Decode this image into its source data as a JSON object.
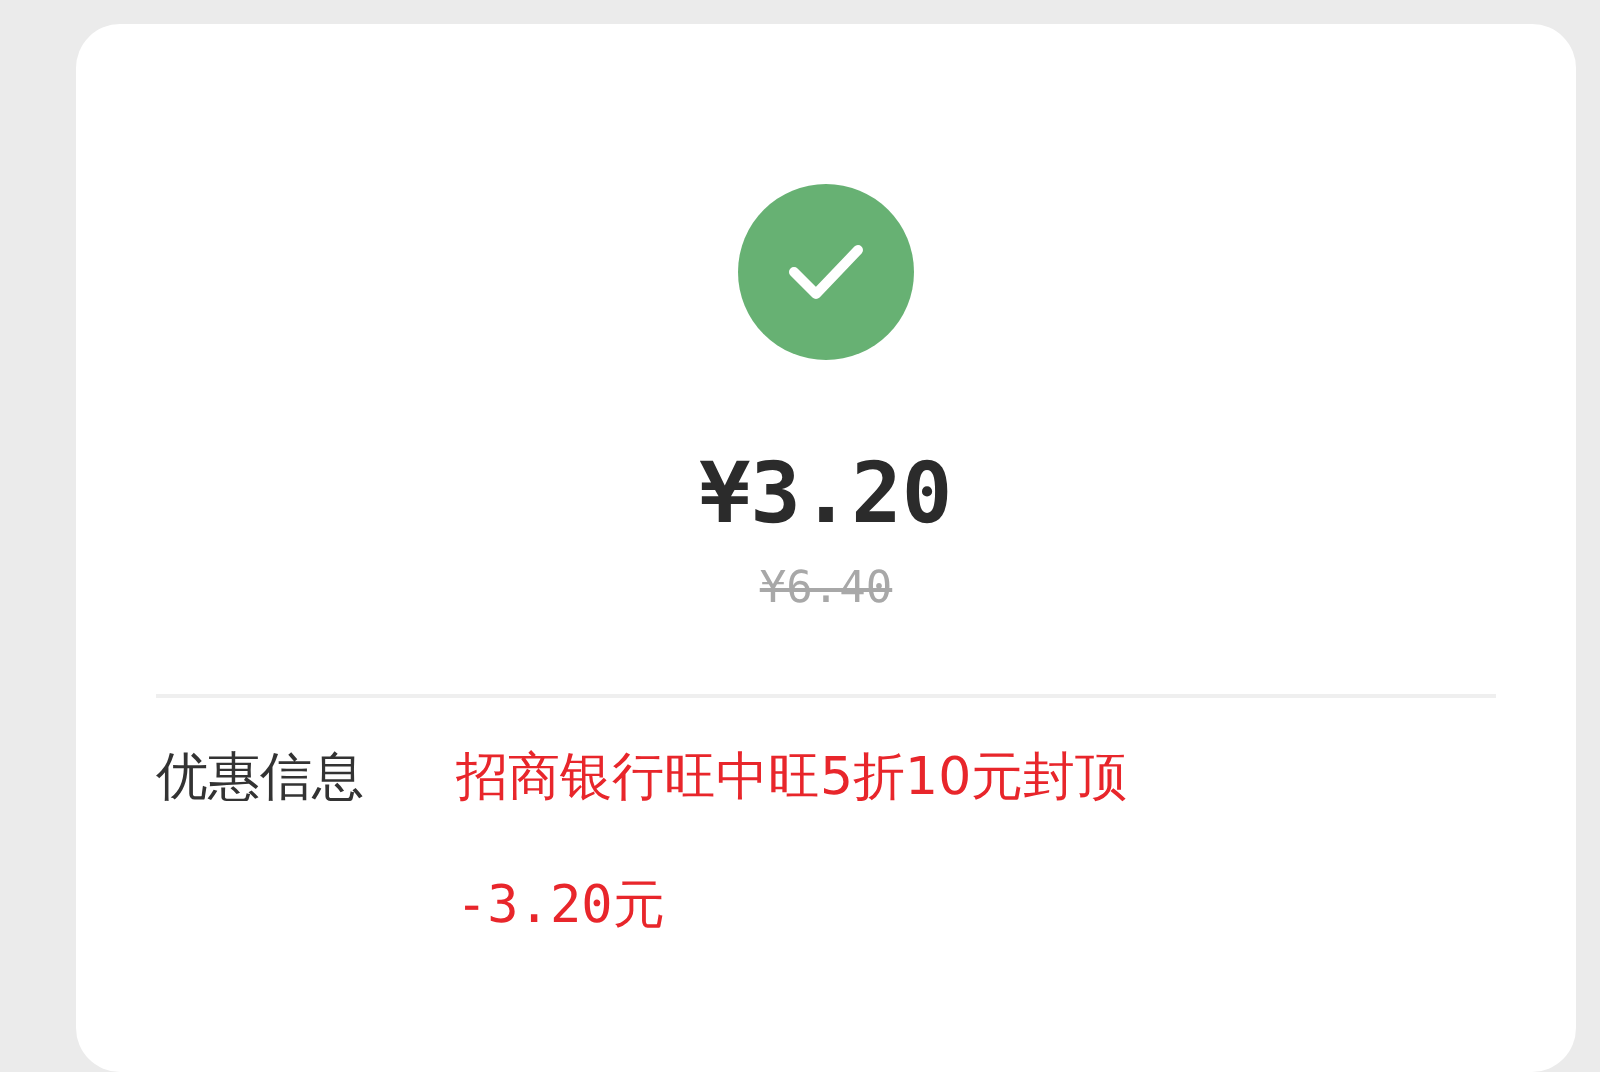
{
  "success": true,
  "price": "¥3.20",
  "original_price": "¥6.40",
  "discount": {
    "label": "优惠信息",
    "lines": [
      "招商银行旺中旺5折10元封顶",
      "-3.20元"
    ]
  }
}
